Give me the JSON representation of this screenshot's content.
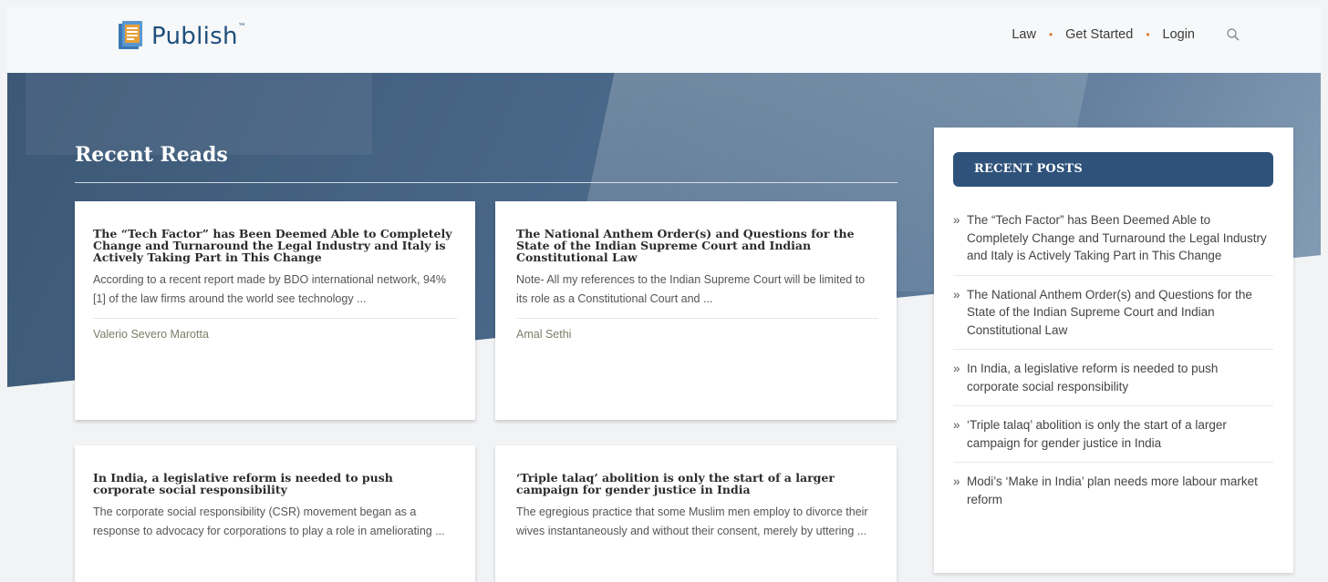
{
  "header": {
    "logo_text": "Publish",
    "logo_tm": "™",
    "nav": [
      {
        "label": "Law"
      },
      {
        "label": "Get Started"
      },
      {
        "label": "Login"
      }
    ],
    "nav_separator": "•"
  },
  "hero": {
    "title": "Recent Reads"
  },
  "cards": [
    {
      "title": "The “Tech Factor” has Been Deemed Able to Completely Change and Turnaround the Legal Industry and Italy is Actively Taking Part in This Change",
      "excerpt": "According to a recent report made by BDO international network, 94%[1] of the law firms around the world see technology ...",
      "author": "Valerio Severo Marotta"
    },
    {
      "title": "The National Anthem Order(s) and Questions for the State of the Indian Supreme Court and Indian Constitutional Law",
      "excerpt": "Note- All my references to the Indian Supreme Court will be limited to its role as a Constitutional Court and ...",
      "author": "Amal Sethi"
    },
    {
      "title": "In India, a legislative reform is needed to push corporate social responsibility",
      "excerpt": "The corporate social responsibility (CSR) movement began as a response to advocacy for corporations to play a role in ameliorating ...",
      "author": ""
    },
    {
      "title": "‘Triple talaq’ abolition is only the start of a larger campaign for gender justice in India",
      "excerpt": "The egregious practice that some Muslim men employ to divorce their wives instantaneously and without their consent, merely by uttering ...",
      "author": ""
    }
  ],
  "sidebar": {
    "heading": "RECENT POSTS",
    "bullet": "»",
    "items": [
      {
        "label": "The “Tech Factor” has Been Deemed Able to Completely Change and Turnaround the Legal Industry and Italy is Actively Taking Part in This Change"
      },
      {
        "label": "The National Anthem Order(s) and Questions for the State of the Indian Supreme Court and Indian Constitutional Law"
      },
      {
        "label": "In India, a legislative reform is needed to push corporate social responsibility"
      },
      {
        "label": "‘Triple talaq’ abolition is only the start of a larger campaign for gender justice in India"
      },
      {
        "label": "Modi’s ‘Make in India’ plan needs more labour market reform"
      }
    ]
  },
  "colors": {
    "brand": "#1f4f7c",
    "nav_dot": "#e0752d",
    "sidebar_header": "#2e527a",
    "hero": "#4a6889"
  },
  "icons": {
    "logo": "book-document-icon",
    "search": "search-icon"
  }
}
